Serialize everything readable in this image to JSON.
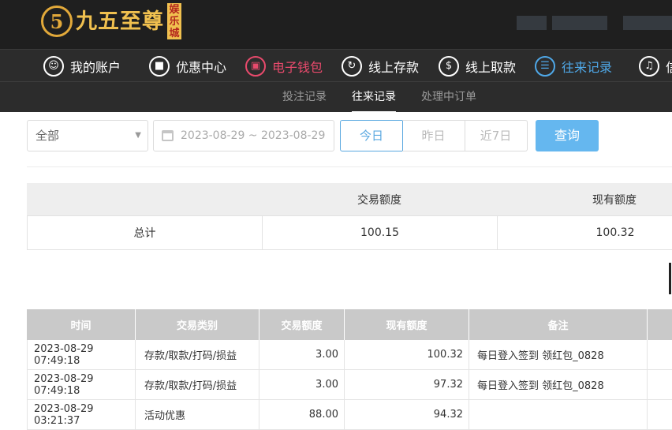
{
  "header": {
    "logo_text": "九五至尊",
    "logo_mark": "5",
    "logo_badge": "娱乐城"
  },
  "nav": {
    "items": [
      {
        "label": "我的账户",
        "icon": "user-icon"
      },
      {
        "label": "优惠中心",
        "icon": "gift-icon"
      },
      {
        "label": "电子钱包",
        "icon": "wallet-icon"
      },
      {
        "label": "线上存款",
        "icon": "deposit-icon"
      },
      {
        "label": "线上取款",
        "icon": "withdraw-icon"
      },
      {
        "label": "往来记录",
        "icon": "records-icon"
      },
      {
        "label": "信",
        "icon": "bell-icon"
      }
    ],
    "active_color": "#4fa8e8",
    "highlight_color": "#e84a6c"
  },
  "subtabs": {
    "items": [
      "投注记录",
      "往来记录",
      "处理中订单"
    ],
    "active": "往来记录"
  },
  "filter": {
    "type_selected": "全部",
    "date_range": "2023-08-29 ~ 2023-08-29",
    "quick_ranges": [
      "今日",
      "昨日",
      "近7日"
    ],
    "quick_active": "今日",
    "query_label": "查询"
  },
  "summary": {
    "headers": [
      "",
      "交易额度",
      "现有额度"
    ],
    "row": [
      "总计",
      "100.15",
      "100.32"
    ]
  },
  "records": {
    "headers": [
      "时间",
      "交易类别",
      "交易额度",
      "现有额度",
      "备注",
      ""
    ],
    "rows": [
      [
        "2023-08-29 07:49:18",
        "存款/取款/打码/损益",
        "3.00",
        "100.32",
        "每日登入签到 领红包_0828"
      ],
      [
        "2023-08-29 07:49:18",
        "存款/取款/打码/损益",
        "3.00",
        "97.32",
        "每日登入签到 领红包_0828"
      ],
      [
        "2023-08-29 03:21:37",
        "活动优惠",
        "88.00",
        "94.32",
        ""
      ]
    ]
  }
}
